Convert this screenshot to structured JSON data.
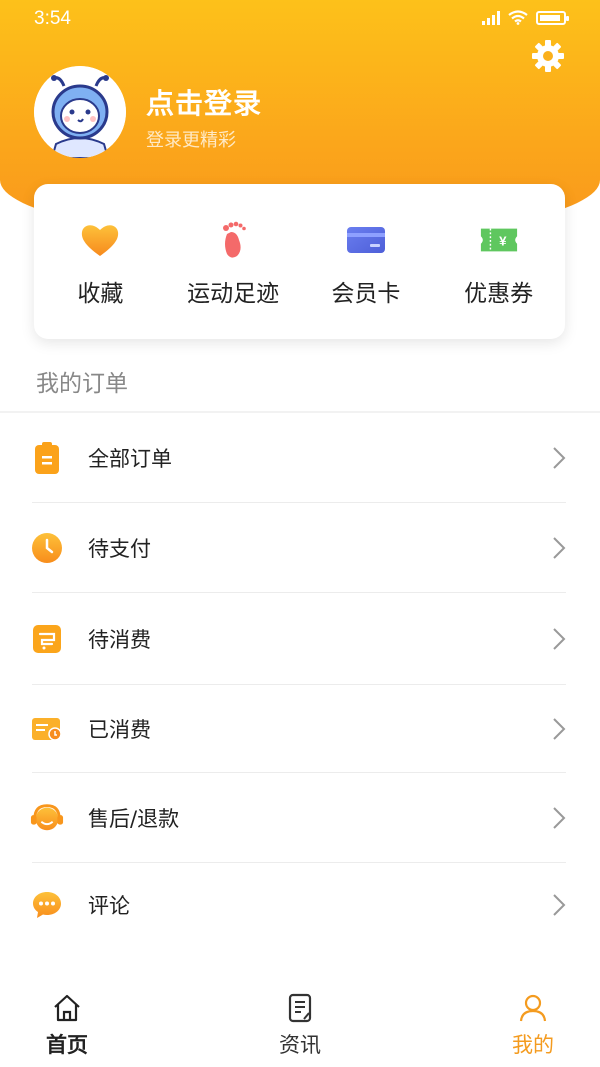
{
  "status_bar": {
    "time": "3:54"
  },
  "header": {
    "login_title": "点击登录",
    "login_subtitle": "登录更精彩",
    "settings_icon": "gear-icon"
  },
  "quick_actions": [
    {
      "label": "收藏",
      "icon": "heart-icon"
    },
    {
      "label": "运动足迹",
      "icon": "footprint-icon"
    },
    {
      "label": "会员卡",
      "icon": "card-icon"
    },
    {
      "label": "优惠券",
      "icon": "coupon-icon"
    }
  ],
  "orders": {
    "title": "我的订单",
    "items": [
      {
        "label": "全部订单",
        "icon": "clipboard-icon"
      },
      {
        "label": "待支付",
        "icon": "clock-icon"
      },
      {
        "label": "待消费",
        "icon": "cart-icon"
      },
      {
        "label": "已消费",
        "icon": "receipt-icon"
      },
      {
        "label": "售后/退款",
        "icon": "headset-icon"
      },
      {
        "label": "评论",
        "icon": "chat-icon"
      }
    ]
  },
  "tabbar": {
    "home": "首页",
    "news": "资讯",
    "me": "我的"
  },
  "colors": {
    "accent": "#f9a01b",
    "active_tab": "#f49b1f"
  }
}
